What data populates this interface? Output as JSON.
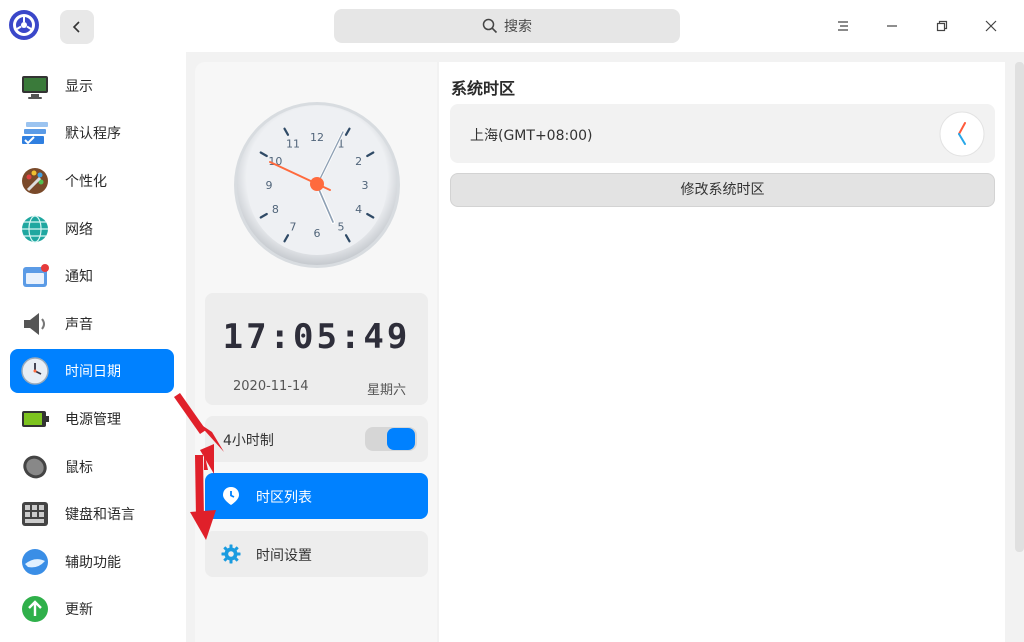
{
  "search": {
    "label": "搜索"
  },
  "sidebar": {
    "items": [
      {
        "label": "显示",
        "icon": "monitor-icon"
      },
      {
        "label": "默认程序",
        "icon": "default-apps-icon"
      },
      {
        "label": "个性化",
        "icon": "palette-icon"
      },
      {
        "label": "网络",
        "icon": "network-icon"
      },
      {
        "label": "通知",
        "icon": "notification-icon"
      },
      {
        "label": "声音",
        "icon": "speaker-icon"
      },
      {
        "label": "时间日期",
        "icon": "clock-icon",
        "active": true
      },
      {
        "label": "电源管理",
        "icon": "battery-icon"
      },
      {
        "label": "鼠标",
        "icon": "mouse-icon"
      },
      {
        "label": "键盘和语言",
        "icon": "keyboard-icon"
      },
      {
        "label": "辅助功能",
        "icon": "accessibility-icon"
      },
      {
        "label": "更新",
        "icon": "update-icon"
      }
    ]
  },
  "clock": {
    "numbers": [
      "12",
      "1",
      "2",
      "3",
      "4",
      "5",
      "6",
      "7",
      "8",
      "9",
      "10",
      "11"
    ],
    "digital_time": "17:05:49",
    "date": "2020-11-14",
    "weekday": "星期六"
  },
  "hour24": {
    "label": "4小时制",
    "enabled": true
  },
  "mid_menu": {
    "timezone_list": "时区列表",
    "time_settings": "时间设置"
  },
  "right": {
    "title": "系统时区",
    "timezone": "上海(GMT+08:00)",
    "change_button": "修改系统时区"
  },
  "colors": {
    "accent": "#0081ff",
    "second_hand": "#ff6a3d",
    "annotation_arrow": "#e0202a"
  }
}
